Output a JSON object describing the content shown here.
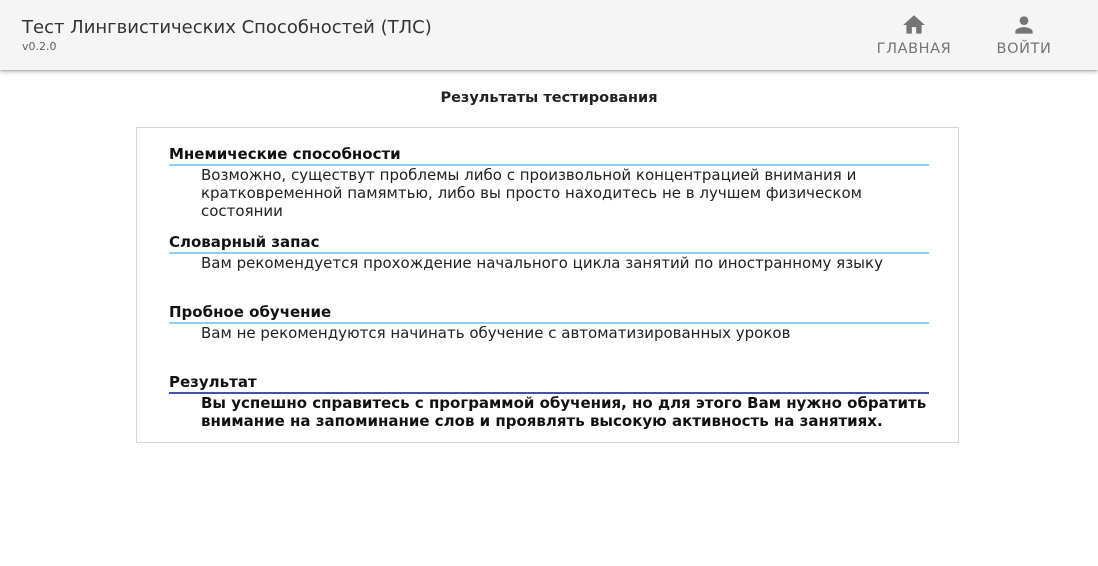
{
  "header": {
    "title": "Тест Лингвистических Способностей (ТЛС)",
    "version": "v0.2.0",
    "nav": {
      "home": {
        "label": "ГЛАВНАЯ",
        "icon": "home-icon"
      },
      "login": {
        "label": "ВОЙТИ",
        "icon": "person-icon"
      }
    },
    "background_color": "#f5f5f5"
  },
  "main": {
    "heading": "Результаты тестирования",
    "sections": [
      {
        "title": "Мнемические способности",
        "text": "Возможно, существут проблемы либо с произвольной концентрацией внимания и кратковременной памямтью, либо вы просто находитесь не в лучшем физическом состоянии"
      },
      {
        "title": "Словарный запас",
        "text": "Вам рекомендуется прохождение начального цикла занятий по иностранному языку"
      },
      {
        "title": "Пробное обучение",
        "text": "Вам не рекомендуются начинать обучение с автоматизированных уроков"
      },
      {
        "title": "Результат",
        "text": "Вы успешно справитесь с программой обучения, но для этого Вам нужно обратить внимание на запоминание слов и проявлять высокую активность на занятиях."
      }
    ],
    "colors": {
      "section_underline": "#90caf9",
      "result_underline": "#3f51b5"
    }
  }
}
